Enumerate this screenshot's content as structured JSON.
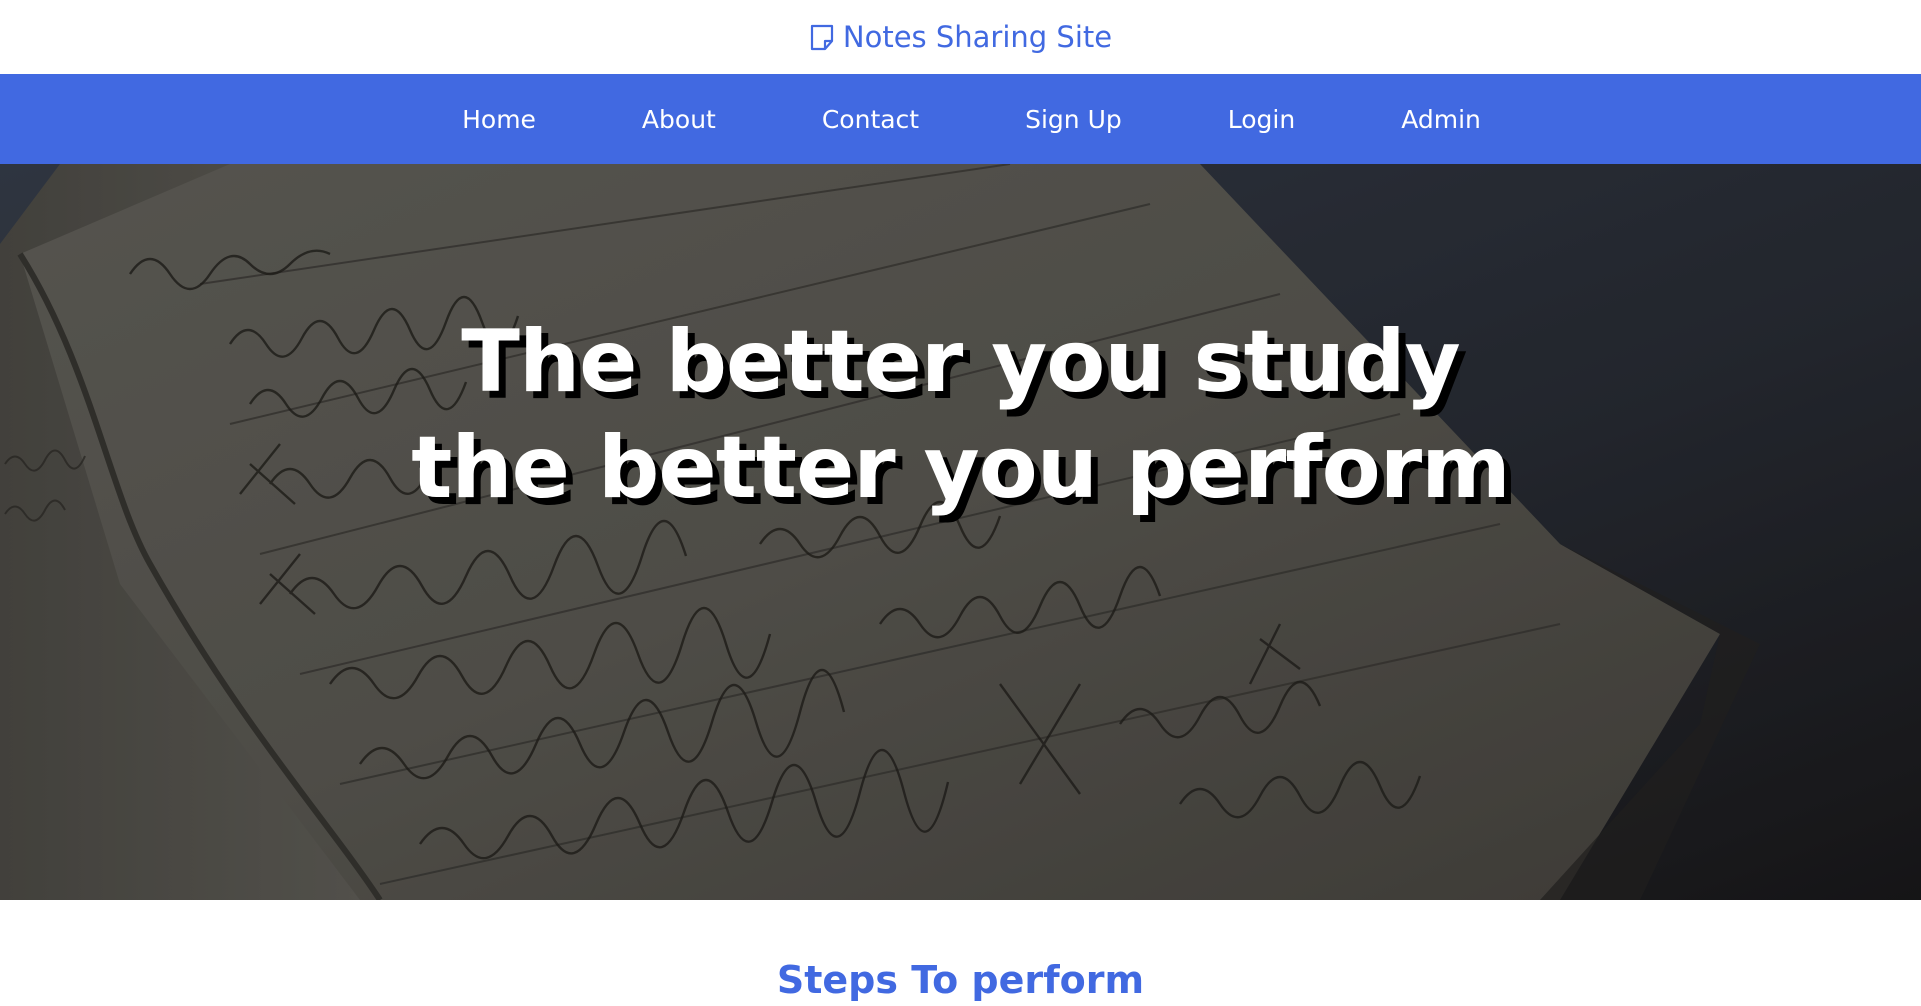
{
  "brand": {
    "icon": "sticky-note-icon",
    "name": "Notes Sharing Site",
    "color": "#4169e1"
  },
  "nav": {
    "background": "#4169e1",
    "items": [
      {
        "label": "Home"
      },
      {
        "label": "About"
      },
      {
        "label": "Contact"
      },
      {
        "label": "Sign Up"
      },
      {
        "label": "Login"
      },
      {
        "label": "Admin"
      }
    ]
  },
  "hero": {
    "line1": "The better you study",
    "line2": "the better you perform"
  },
  "steps": {
    "title": "Steps To perform"
  }
}
